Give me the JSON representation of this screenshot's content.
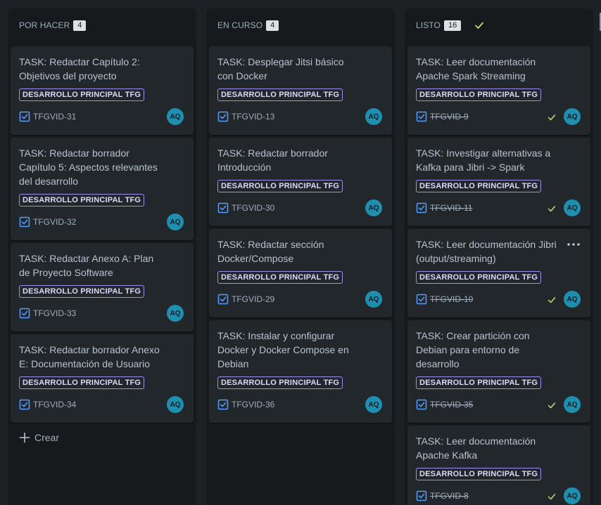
{
  "colors": {
    "background": "#1d2125",
    "column": "#161a1d",
    "card": "#22272b",
    "epic_border": "#9f8fef",
    "avatar": "#1f8fb0",
    "done_check": "#b3df72",
    "task_icon": "#579dff"
  },
  "columns": [
    {
      "title": "POR HACER",
      "count": "4",
      "create_label": "Crear",
      "cards": [
        {
          "title": "TASK: Redactar Capítulo 2: Objetivos del proyecto",
          "epic": "DESARROLLO PRINCIPAL TFG",
          "key": "TFGVID-31",
          "avatar": "AQ"
        },
        {
          "title": "TASK: Redactar borrador Capítulo 5: Aspectos relevantes del desarrollo",
          "epic": "DESARROLLO PRINCIPAL TFG",
          "key": "TFGVID-32",
          "avatar": "AQ"
        },
        {
          "title": "TASK: Redactar Anexo A: Plan de Proyecto Software",
          "epic": "DESARROLLO PRINCIPAL TFG",
          "key": "TFGVID-33",
          "avatar": "AQ"
        },
        {
          "title": "TASK: Redactar borrador Anexo E: Documentación de Usuario",
          "epic": "DESARROLLO PRINCIPAL TFG",
          "key": "TFGVID-34",
          "avatar": "AQ"
        }
      ]
    },
    {
      "title": "EN CURSO",
      "count": "4",
      "cards": [
        {
          "title": "TASK: Desplegar Jitsi básico con Docker",
          "epic": "DESARROLLO PRINCIPAL TFG",
          "key": "TFGVID-13",
          "avatar": "AQ"
        },
        {
          "title": "TASK: Redactar borrador Introducción",
          "epic": "DESARROLLO PRINCIPAL TFG",
          "key": "TFGVID-30",
          "avatar": "AQ"
        },
        {
          "title": "TASK: Redactar sección Docker/Compose",
          "epic": "DESARROLLO PRINCIPAL TFG",
          "key": "TFGVID-29",
          "avatar": "AQ"
        },
        {
          "title": "TASK: Instalar y configurar Docker y Docker Compose en Debian",
          "epic": "DESARROLLO PRINCIPAL TFG",
          "key": "TFGVID-36",
          "avatar": "AQ"
        }
      ]
    },
    {
      "title": "LISTO",
      "count": "16",
      "cards": [
        {
          "title": "TASK: Leer documentación Apache Spark Streaming",
          "epic": "DESARROLLO PRINCIPAL TFG",
          "key": "TFGVID-9",
          "avatar": "AQ"
        },
        {
          "title": "TASK: Investigar alternativas a Kafka para Jibri -> Spark",
          "epic": "DESARROLLO PRINCIPAL TFG",
          "key": "TFGVID-11",
          "avatar": "AQ"
        },
        {
          "title": "TASK: Leer documentación Jibri (output/streaming)",
          "epic": "DESARROLLO PRINCIPAL TFG",
          "key": "TFGVID-10",
          "avatar": "AQ"
        },
        {
          "title": "TASK: Crear partición con Debian para entorno de desarrollo",
          "epic": "DESARROLLO PRINCIPAL TFG",
          "key": "TFGVID-35",
          "avatar": "AQ"
        },
        {
          "title": "TASK: Leer documentación Apache Kafka",
          "epic": "DESARROLLO PRINCIPAL TFG",
          "key": "TFGVID-8",
          "avatar": "AQ"
        }
      ]
    }
  ]
}
